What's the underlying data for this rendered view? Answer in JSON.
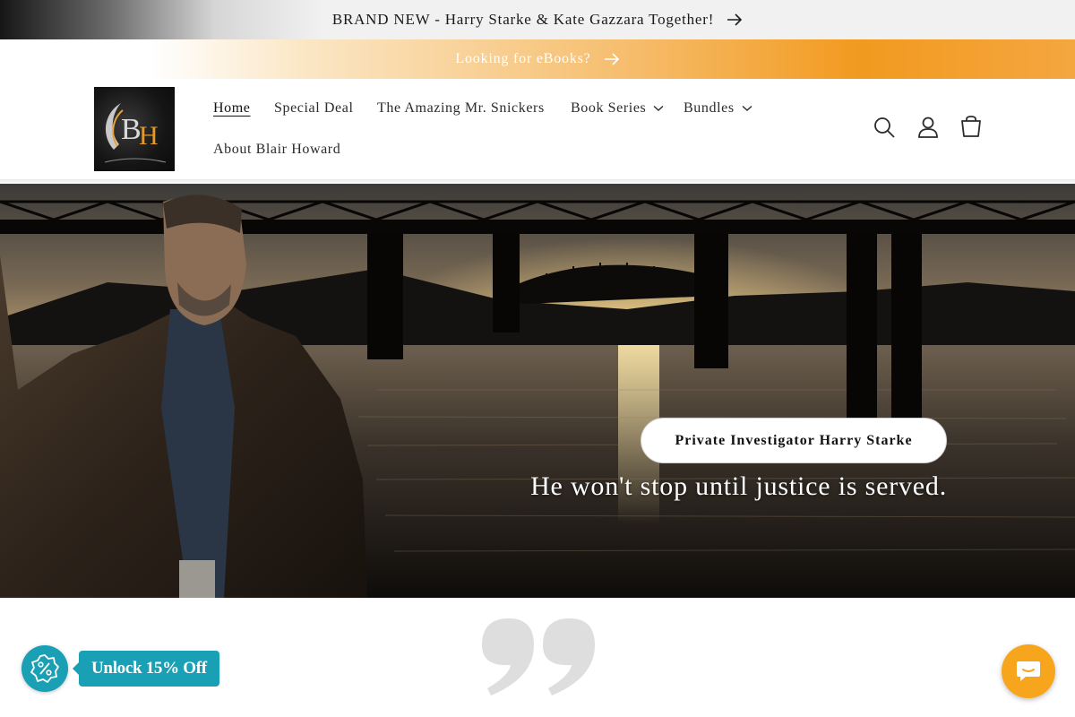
{
  "announcements": {
    "primary": "BRAND NEW - Harry Starke & Kate Gazzara Together!",
    "secondary": "Looking for eBooks?"
  },
  "header": {
    "logo_alt": "BH Blair Howard Books",
    "nav": [
      {
        "label": "Home",
        "active": true
      },
      {
        "label": "Special Deal"
      },
      {
        "label": "The Amazing Mr. Snickers"
      },
      {
        "label": "Book Series",
        "dropdown": true
      },
      {
        "label": "Bundles",
        "dropdown": true
      },
      {
        "label": "About Blair Howard"
      }
    ],
    "icons": [
      "search-icon",
      "account-icon",
      "cart-icon"
    ]
  },
  "hero": {
    "button_label": "Private Investigator Harry Starke",
    "tagline": "He won't stop until justice is served."
  },
  "widgets": {
    "discount_label": "Unlock 15% Off",
    "discount_icon": "percent-badge-icon",
    "chat_icon": "chat-bubble-icon"
  },
  "colors": {
    "accent_orange": "#f29a1f",
    "widget_teal": "#1aa0b4",
    "chat_orange": "#f7a51c"
  }
}
